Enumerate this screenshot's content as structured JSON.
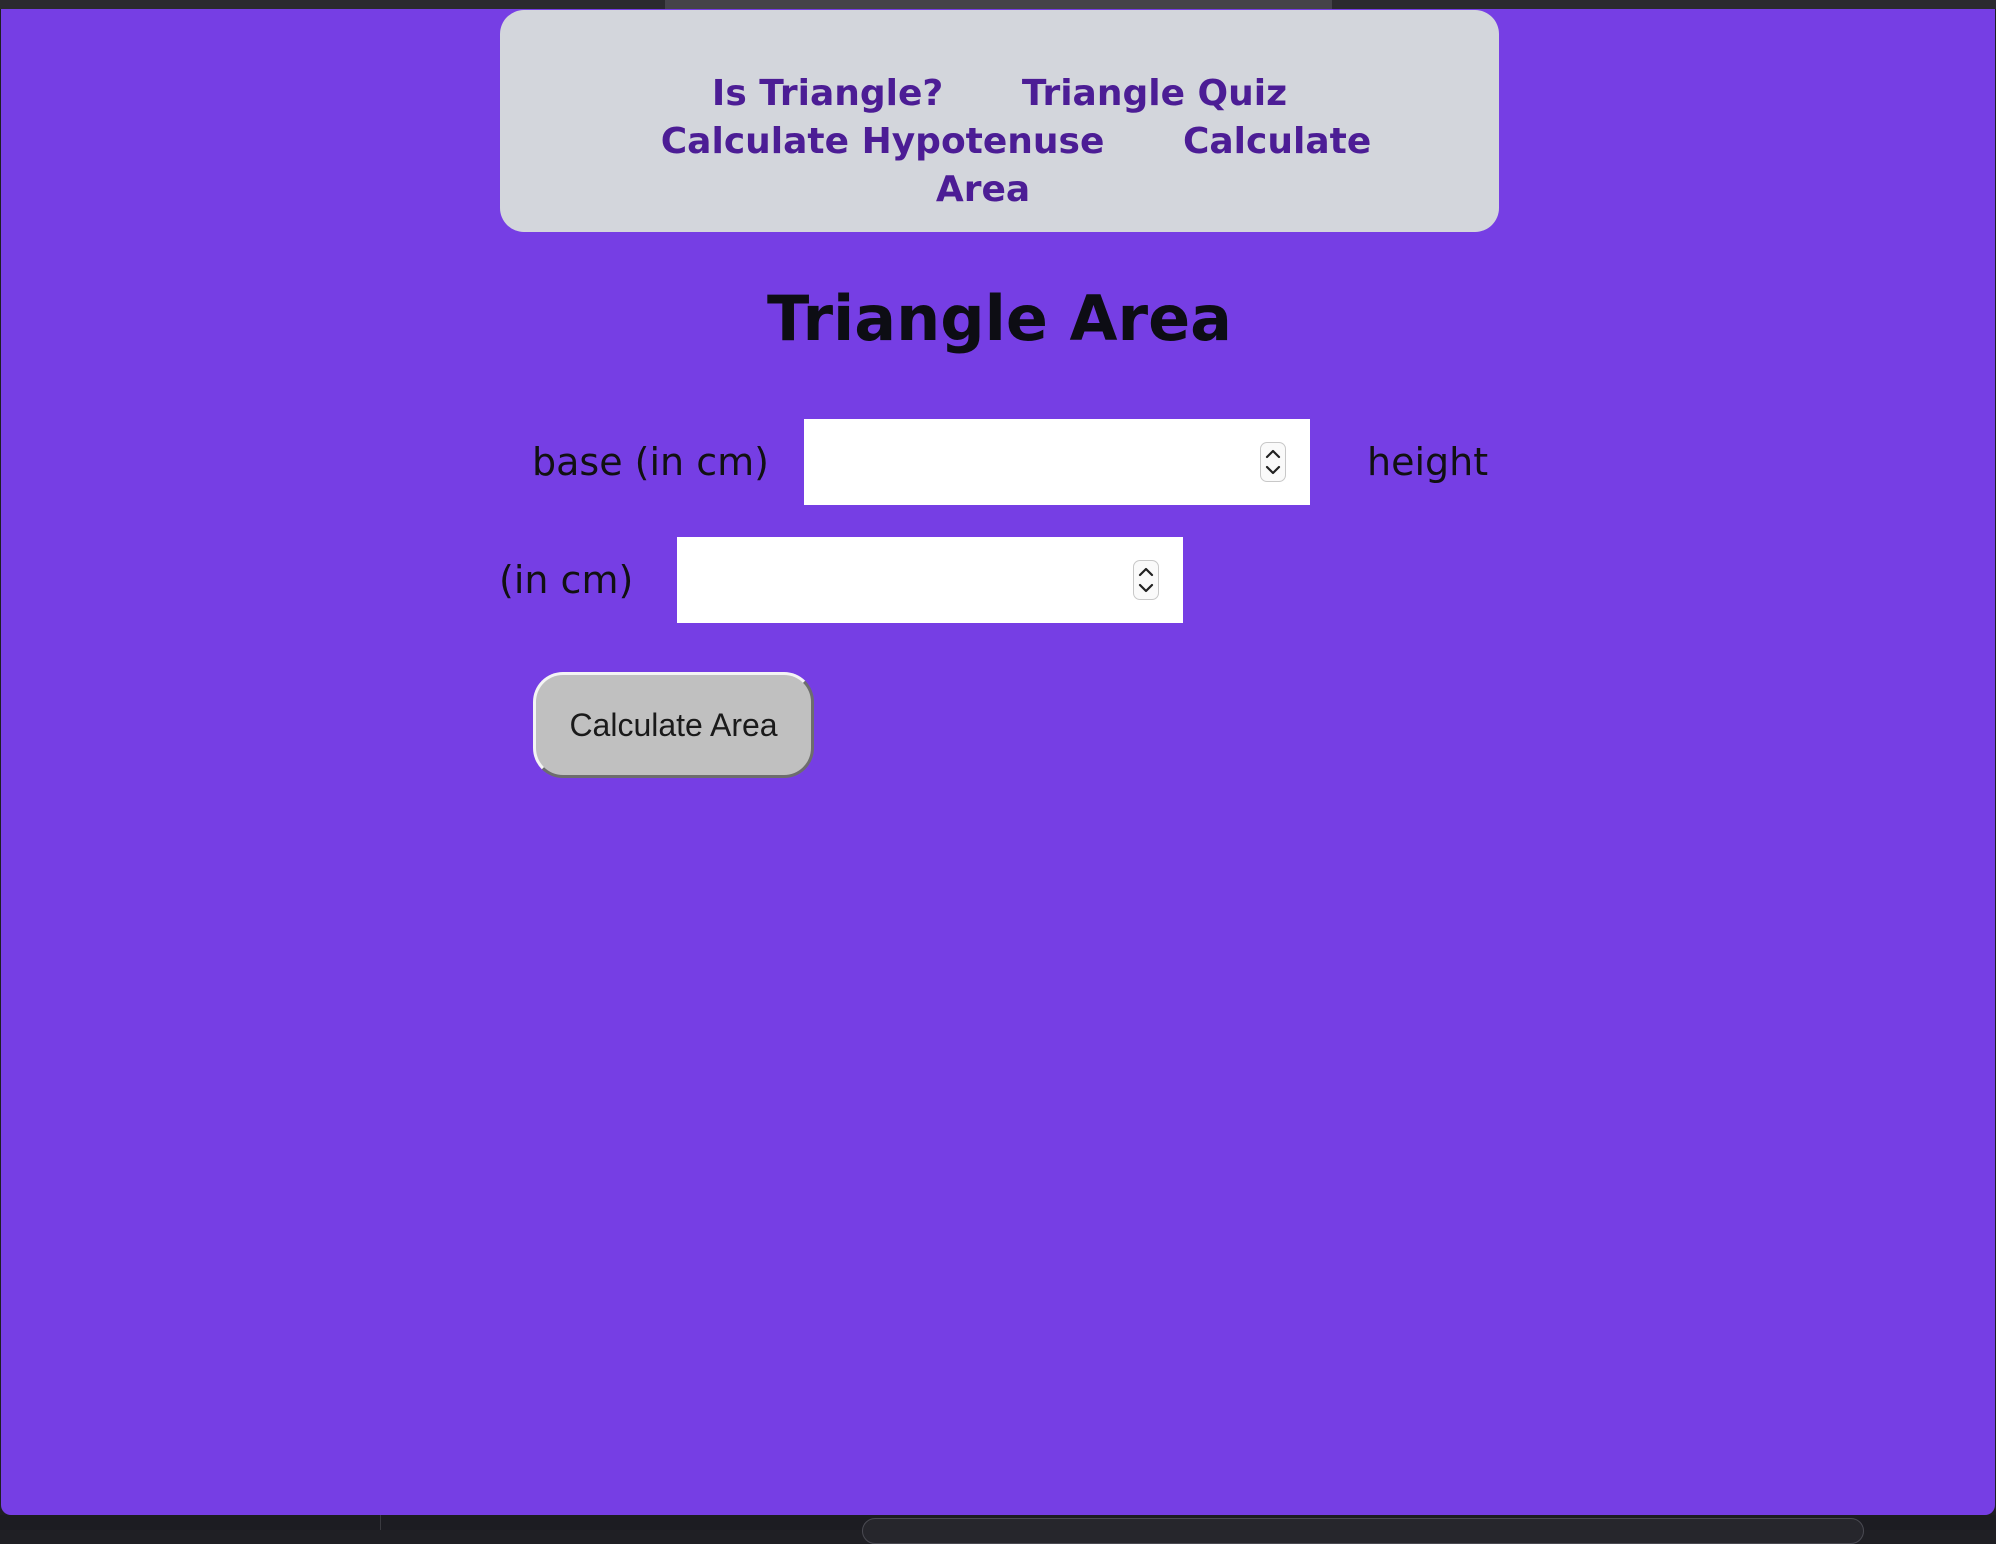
{
  "nav": {
    "items": [
      {
        "label": "Is Triangle?"
      },
      {
        "label": "Triangle Quiz"
      },
      {
        "label": "Calculate Hypotenuse"
      },
      {
        "label": "Calculate Area"
      }
    ]
  },
  "main": {
    "title": "Triangle Area",
    "base_label": "base (in cm)",
    "height_label_part1": "height",
    "height_label_part2": "(in cm)",
    "base_value": "",
    "height_value": "",
    "button_label": "Calculate Area"
  },
  "colors": {
    "page_background": "#763ee4",
    "nav_background": "#d3d6dc",
    "nav_link": "#4c1d95",
    "button_background": "#c0c0c0"
  }
}
